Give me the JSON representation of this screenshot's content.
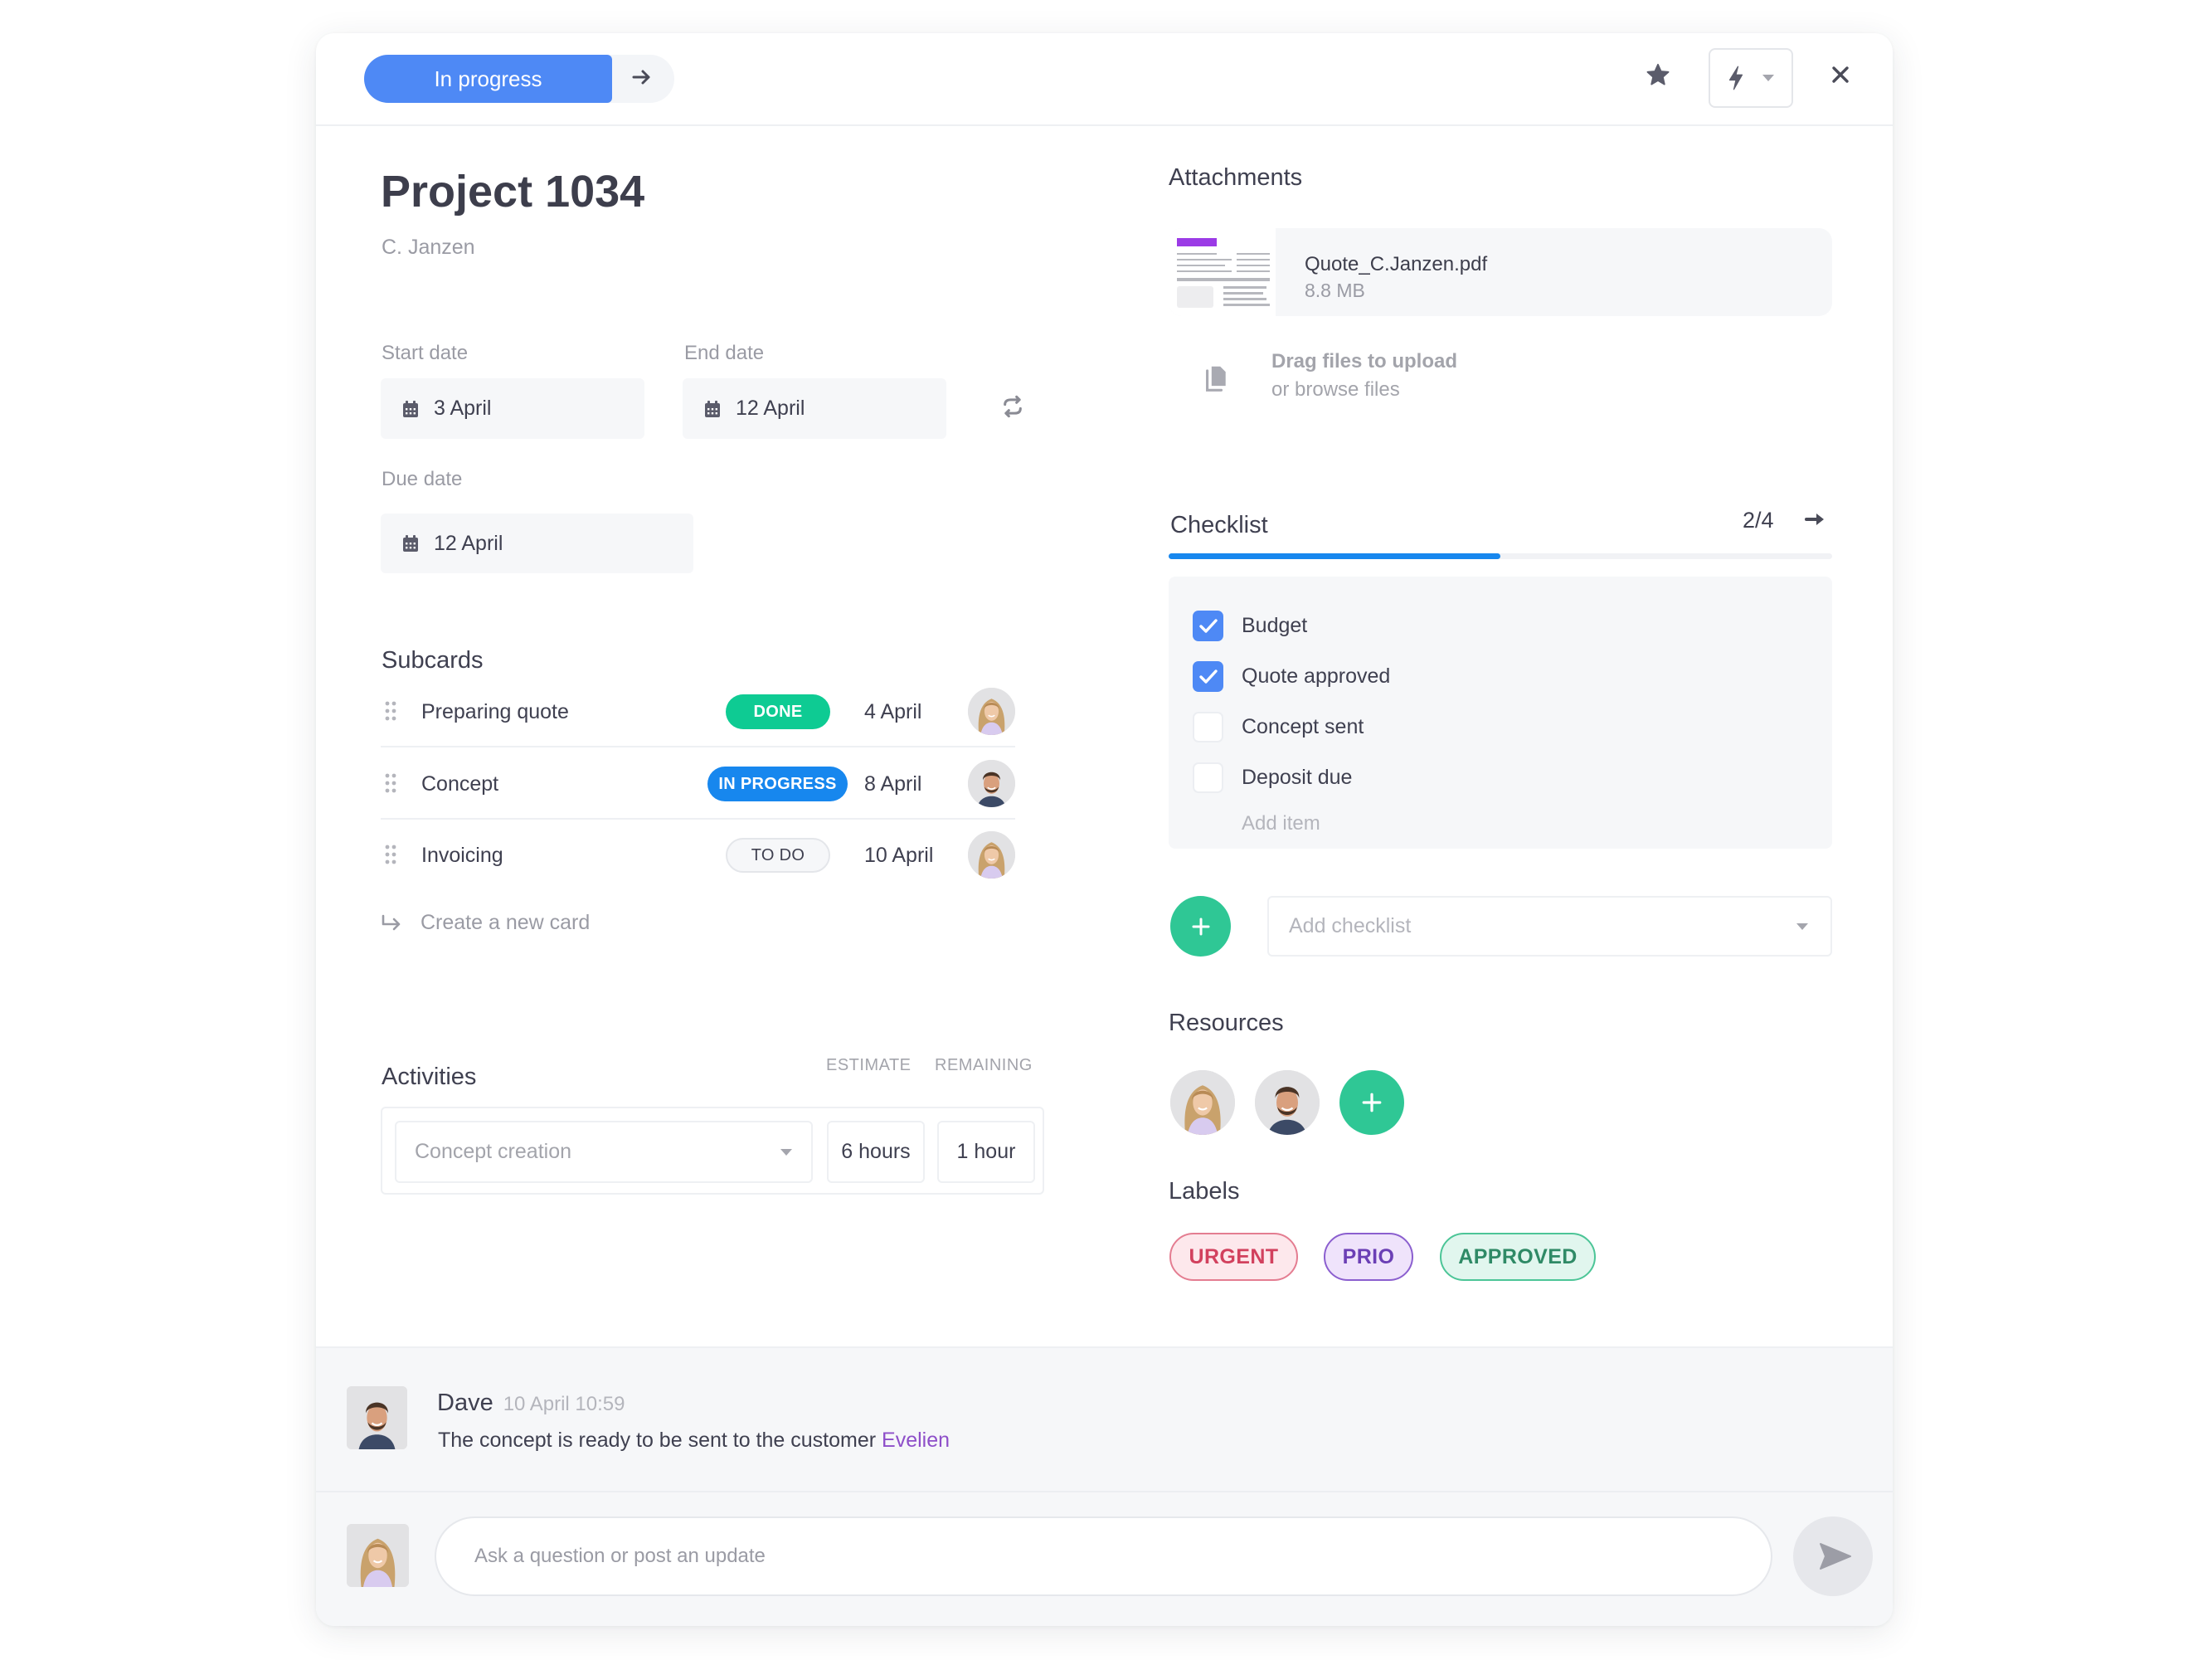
{
  "header": {
    "status_label": "In progress",
    "icons": [
      "arrow-right-icon",
      "star-icon",
      "lightning-icon",
      "caret-down-icon",
      "close-icon"
    ]
  },
  "project": {
    "title": "Project 1034",
    "client": "C. Janzen"
  },
  "dates": {
    "start_label": "Start date",
    "start_value": "3 April",
    "end_label": "End date",
    "end_value": "12 April",
    "due_label": "Due date",
    "due_value": "12 April"
  },
  "subcards": {
    "title": "Subcards",
    "items": [
      {
        "name": "Preparing quote",
        "status": "DONE",
        "date": "4 April",
        "assignee": "woman"
      },
      {
        "name": "Concept",
        "status": "IN PROGRESS",
        "date": "8 April",
        "assignee": "man"
      },
      {
        "name": "Invoicing",
        "status": "TO DO",
        "date": "10 April",
        "assignee": "woman"
      }
    ],
    "create_label": "Create a new card"
  },
  "activities": {
    "title": "Activities",
    "estimate_header": "ESTIMATE",
    "remaining_header": "REMAINING",
    "activity_placeholder": "Concept creation",
    "estimate_value": "6 hours",
    "remaining_value": "1 hour"
  },
  "attachments": {
    "title": "Attachments",
    "files": [
      {
        "name": "Quote_C.Janzen.pdf",
        "size": "8.8 MB"
      }
    ],
    "upload_primary": "Drag files to upload",
    "upload_secondary": "or browse files"
  },
  "checklist": {
    "title": "Checklist",
    "progress_text": "2/4",
    "progress_fraction": 0.5,
    "items": [
      {
        "label": "Budget",
        "checked": true
      },
      {
        "label": "Quote approved",
        "checked": true
      },
      {
        "label": "Concept sent",
        "checked": false
      },
      {
        "label": "Deposit due",
        "checked": false
      }
    ],
    "add_item_placeholder": "Add item",
    "add_checklist_placeholder": "Add checklist"
  },
  "resources": {
    "title": "Resources",
    "people": [
      "woman",
      "man"
    ]
  },
  "labels": {
    "title": "Labels",
    "items": [
      {
        "text": "URGENT",
        "color": "#d2415e",
        "bg": "#fde8ec",
        "border": "#e47d91"
      },
      {
        "text": "PRIO",
        "color": "#6b3fb5",
        "bg": "#efe3fb",
        "border": "#8b5fcf"
      },
      {
        "text": "APPROVED",
        "color": "#2f8a66",
        "bg": "#e1f6ee",
        "border": "#4cc597"
      }
    ]
  },
  "comments": [
    {
      "author": "Dave",
      "timestamp": "10 April 10:59",
      "text": "The concept is ready to be sent to the customer ",
      "mention": "Evelien"
    }
  ],
  "compose": {
    "placeholder": "Ask a question or post an update"
  },
  "colors": {
    "accent_blue": "#4e89f5",
    "progress_blue": "#1787ee",
    "done_green": "#0ecb93",
    "in_progress_blue": "#1787ee",
    "add_green": "#2fc795",
    "mention_purple": "#8e4fc9"
  }
}
